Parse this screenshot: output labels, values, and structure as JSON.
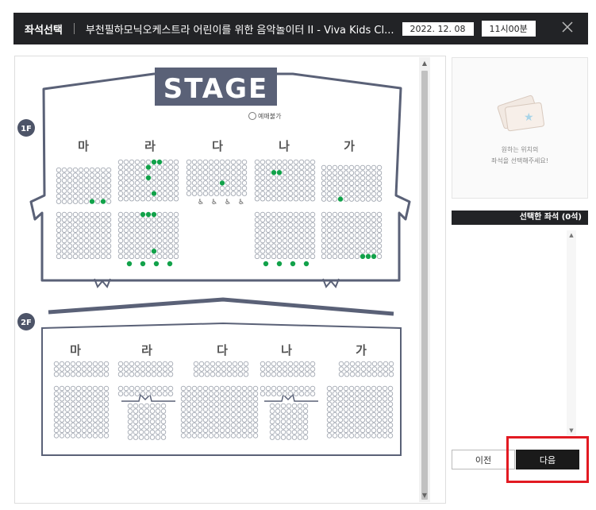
{
  "header": {
    "title": "좌석선택",
    "event": "부천필하모닉오케스트라 어린이를 위한 음악놀이터 II - Viva Kids Cl...",
    "date": "2022. 12. 08",
    "time": "11시00분"
  },
  "map": {
    "stage": "STAGE",
    "unavailable_label": "예매불가",
    "floor1": "1F",
    "floor2": "2F",
    "sections": [
      "마",
      "라",
      "다",
      "나",
      "가"
    ]
  },
  "preview": {
    "hint_line1": "원하는 위치의",
    "hint_line2": "좌석을 선택해주세요!"
  },
  "selected": {
    "label": "선택한 좌석 (0석)"
  },
  "buttons": {
    "prev": "이전",
    "next": "다음"
  },
  "colors": {
    "booked": "#12a24a",
    "available_seat": "#ffffff",
    "outline": "#5a6177"
  }
}
